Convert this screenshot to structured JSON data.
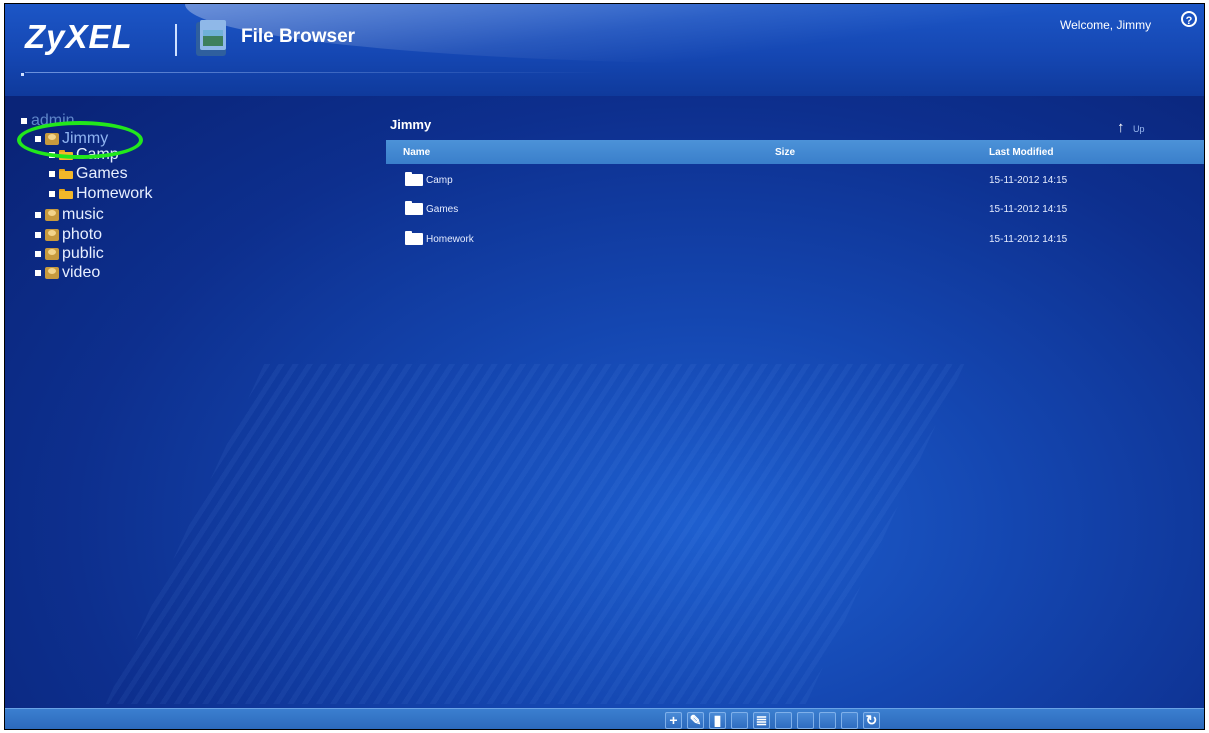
{
  "header": {
    "brand": "ZyXEL",
    "app_title": "File Browser",
    "welcome_text": "Welcome, Jimmy",
    "help_icon": "help-icon",
    "help_glyph": "?"
  },
  "tree": {
    "root_label": "admin",
    "items": [
      {
        "label": "Jimmy",
        "icon": "user-folder-icon",
        "selected": true
      },
      {
        "label": "Camp",
        "icon": "folder-icon"
      },
      {
        "label": "Games",
        "icon": "folder-icon"
      },
      {
        "label": "Homework",
        "icon": "folder-icon"
      },
      {
        "label": "music",
        "icon": "user-folder-icon"
      },
      {
        "label": "photo",
        "icon": "user-folder-icon"
      },
      {
        "label": "public",
        "icon": "user-folder-icon"
      },
      {
        "label": "video",
        "icon": "user-folder-icon"
      }
    ]
  },
  "main": {
    "folder_title": "Jimmy",
    "up_label": "Up",
    "up_glyph": "↑",
    "columns": {
      "name": "Name",
      "size": "Size",
      "modified": "Last Modified"
    },
    "rows": [
      {
        "name": "Camp",
        "size": "",
        "modified": "15-11-2012 14:15"
      },
      {
        "name": "Games",
        "size": "",
        "modified": "15-11-2012 14:15"
      },
      {
        "name": "Homework",
        "size": "",
        "modified": "15-11-2012 14:15"
      }
    ]
  },
  "toolbar": {
    "buttons": [
      {
        "icon": "add-folder-icon",
        "glyph": "+",
        "enabled": true
      },
      {
        "icon": "rename-icon",
        "glyph": "✎",
        "enabled": true
      },
      {
        "icon": "delete-icon",
        "glyph": "▮",
        "enabled": true
      },
      {
        "icon": "cut-icon",
        "glyph": "",
        "enabled": false
      },
      {
        "icon": "properties-icon",
        "glyph": "≣",
        "enabled": true
      },
      {
        "icon": "copy-icon",
        "glyph": "",
        "enabled": false
      },
      {
        "icon": "paste-icon",
        "glyph": "",
        "enabled": false
      },
      {
        "icon": "move-icon",
        "glyph": "",
        "enabled": false
      },
      {
        "icon": "download-icon",
        "glyph": "",
        "enabled": false
      },
      {
        "icon": "refresh-icon",
        "glyph": "↻",
        "enabled": true
      }
    ]
  },
  "colors": {
    "highlight": "#22e81c",
    "table_header": "#3a7fcb"
  }
}
